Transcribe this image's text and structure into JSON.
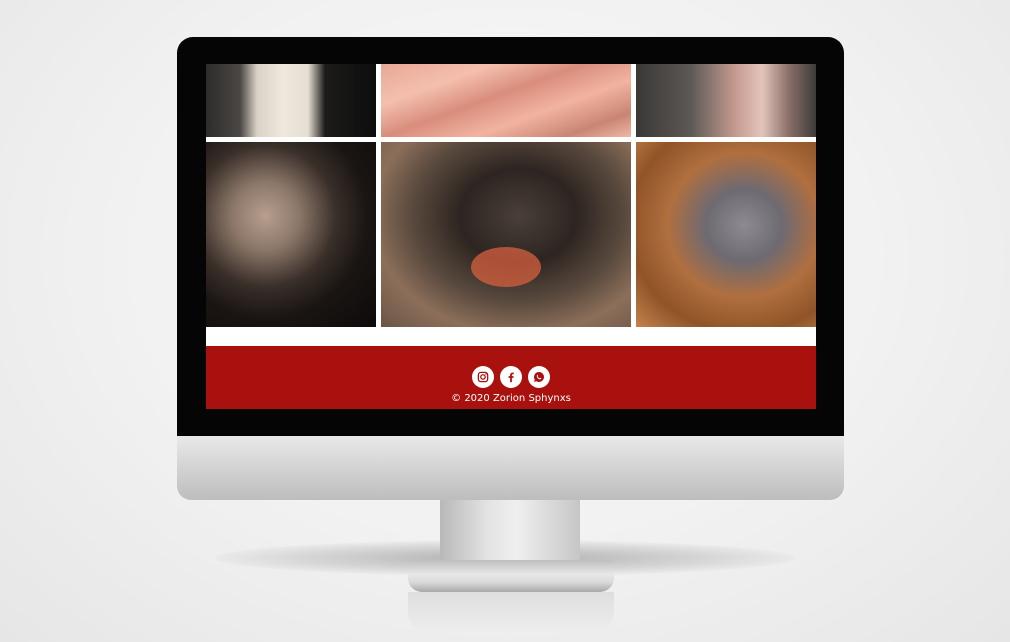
{
  "colors": {
    "footer_bg": "#a8110d",
    "icon_bg": "#ffffff",
    "icon_fg": "#a8110d"
  },
  "gallery": {
    "photos": [
      {
        "name": "photo-cat-tree"
      },
      {
        "name": "photo-pink-fur"
      },
      {
        "name": "photo-cat-bed"
      },
      {
        "name": "photo-sphynx-blanket"
      },
      {
        "name": "photo-sphynx-toy"
      },
      {
        "name": "photo-sphynx-kittens"
      }
    ]
  },
  "footer": {
    "social": [
      {
        "icon": "instagram-icon"
      },
      {
        "icon": "facebook-icon"
      },
      {
        "icon": "whatsapp-icon"
      }
    ],
    "copyright": "© 2020 Zorion Sphynxs"
  }
}
